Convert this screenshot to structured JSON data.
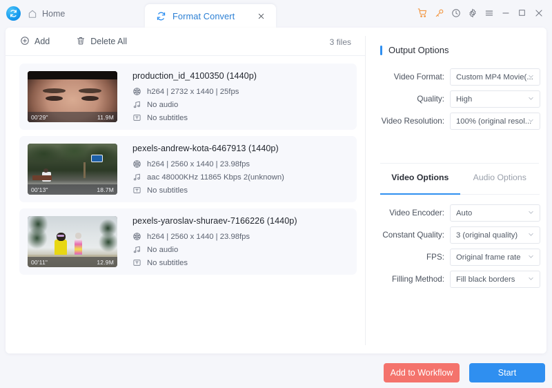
{
  "titlebar": {
    "logo_icon": "app-logo-icon",
    "home_label": "Home",
    "home_icon": "home-icon",
    "tab_label": "Format Convert",
    "tab_icon": "convert-refresh-icon",
    "tab_close_icon": "close-icon",
    "window_buttons": [
      {
        "name": "cart-icon",
        "glyph": "cart",
        "color": "#f2953f"
      },
      {
        "name": "key-icon",
        "glyph": "key",
        "color": "#f2953f"
      },
      {
        "name": "history-clock-icon",
        "glyph": "clock",
        "color": "#6a6f7a"
      },
      {
        "name": "settings-gear-icon",
        "glyph": "gear",
        "color": "#6a6f7a"
      },
      {
        "name": "menu-icon",
        "glyph": "menu",
        "color": "#6a6f7a"
      },
      {
        "name": "minimize-icon",
        "glyph": "minimize",
        "color": "#6a6f7a"
      },
      {
        "name": "maximize-icon",
        "glyph": "maximize",
        "color": "#6a6f7a"
      },
      {
        "name": "close-window-icon",
        "glyph": "close",
        "color": "#6a6f7a"
      }
    ]
  },
  "toolbar": {
    "add_label": "Add",
    "add_icon": "plus-circle-icon",
    "delete_all_label": "Delete All",
    "delete_all_icon": "trash-icon",
    "file_count": "3 files"
  },
  "files": [
    {
      "name": "production_id_4100350 (1440p)",
      "duration": "00'29\"",
      "size": "11.9M",
      "codec": "h264",
      "width": "2732",
      "height": "1440",
      "fps": "25fps",
      "video_line": "h264  |  2732  x  1440  |  25fps",
      "audio": "No audio",
      "subtitles": "No subtitles",
      "video_icon": "film-reel-icon",
      "audio_icon": "music-note-icon",
      "subtitle_icon": "subtitle-icon"
    },
    {
      "name": "pexels-andrew-kota-6467913 (1440p)",
      "duration": "00'13\"",
      "size": "18.7M",
      "codec": "h264",
      "width": "2560",
      "height": "1440",
      "fps": "23.98fps",
      "video_line": "h264  |  2560  x  1440  |  23.98fps",
      "audio": "aac   48000KHz    11865 Kbps     2(unknown)",
      "subtitles": "No subtitles",
      "video_icon": "film-reel-icon",
      "audio_icon": "music-note-icon",
      "subtitle_icon": "subtitle-icon"
    },
    {
      "name": "pexels-yaroslav-shuraev-7166226 (1440p)",
      "duration": "00'11\"",
      "size": "12.9M",
      "codec": "h264",
      "width": "2560",
      "height": "1440",
      "fps": "23.98fps",
      "video_line": "h264  |  2560  x  1440  |  23.98fps",
      "audio": "No audio",
      "subtitles": "No subtitles",
      "video_icon": "film-reel-icon",
      "audio_icon": "music-note-icon",
      "subtitle_icon": "subtitle-icon"
    }
  ],
  "output_options": {
    "title": "Output Options",
    "fields": [
      {
        "label": "Video Format:",
        "value": "Custom MP4 Movie(..."
      },
      {
        "label": "Quality:",
        "value": "High"
      },
      {
        "label": "Video Resolution:",
        "value": "100% (original resol..."
      }
    ]
  },
  "option_tabs": [
    {
      "label": "Video Options",
      "active": true
    },
    {
      "label": "Audio Options",
      "active": false
    }
  ],
  "video_options": {
    "fields": [
      {
        "label": "Video Encoder:",
        "value": "Auto"
      },
      {
        "label": "Constant Quality:",
        "value": "3 (original quality)"
      },
      {
        "label": "FPS:",
        "value": "Original frame rate"
      },
      {
        "label": "Filling Method:",
        "value": "Fill black borders"
      }
    ]
  },
  "footer": {
    "add_to_workflow_label": "Add to Workflow",
    "start_label": "Start"
  },
  "colors": {
    "accent_blue": "#2f8ff0",
    "start_button": "#2f8ff0",
    "workflow_button": "#f4736c",
    "orange_icon": "#f2953f",
    "page_bg": "#f5f6fa",
    "row_bg": "#f7f8fc"
  }
}
